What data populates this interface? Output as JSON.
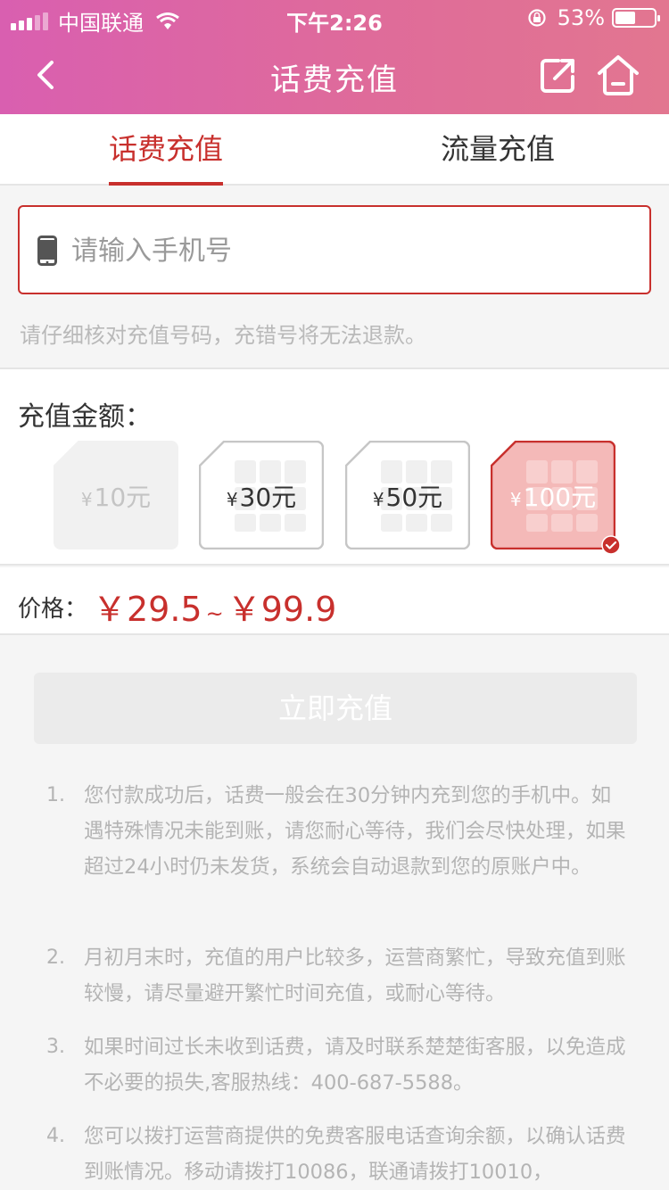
{
  "status_bar": {
    "carrier": "中国联通",
    "time": "下午2:26",
    "battery_text": "53%",
    "battery_level": 0.53
  },
  "header": {
    "title": "话费充值"
  },
  "tabs": [
    {
      "label": "话费充值",
      "active": true
    },
    {
      "label": "流量充值",
      "active": false
    }
  ],
  "phone_input": {
    "placeholder": "请输入手机号",
    "value": ""
  },
  "hint": "请仔细核对充值号码，充错号将无法退款。",
  "amount": {
    "label": "充值金额：",
    "currency": "¥",
    "options": [
      {
        "value": "10元",
        "state": "disabled"
      },
      {
        "value": "30元",
        "state": "normal"
      },
      {
        "value": "50元",
        "state": "normal"
      },
      {
        "value": "100元",
        "state": "selected"
      }
    ]
  },
  "price": {
    "label": "价格：",
    "min": "￥29.5",
    "separator": "~",
    "max": "￥99.9"
  },
  "submit_label": "立即充值",
  "notes": [
    {
      "num": "1.",
      "text": "您付款成功后，话费一般会在30分钟内充到您的手机中。如遇特殊情况未能到账，请您耐心等待，我们会尽快处理，如果超过24小时仍未发货，系统会自动退款到您的原账户中。"
    },
    {
      "num": "2.",
      "text": "月初月末时，充值的用户比较多，运营商繁忙，导致充值到账较慢，请尽量避开繁忙时间充值，或耐心等待。"
    },
    {
      "num": "3.",
      "text": "如果时间过长未收到话费，请及时联系楚楚街客服，以免造成不必要的损失,客服热线：400-687-5588。"
    },
    {
      "num": "4.",
      "text": "您可以拨打运营商提供的免费客服电话查询余额，以确认话费到账情况。移动请拨打10086，联通请拨打10010，"
    }
  ],
  "colors": {
    "accent": "#c8302d",
    "header_start": "#d95fb0",
    "header_end": "#e27690",
    "selected_fill": "#f4b9b8"
  },
  "icons": [
    "signal-icon",
    "wifi-icon",
    "rotation-lock-icon",
    "battery-icon",
    "back-chevron-icon",
    "share-icon",
    "home-icon",
    "phone-icon",
    "sim-card-icon",
    "checkmark-icon"
  ]
}
